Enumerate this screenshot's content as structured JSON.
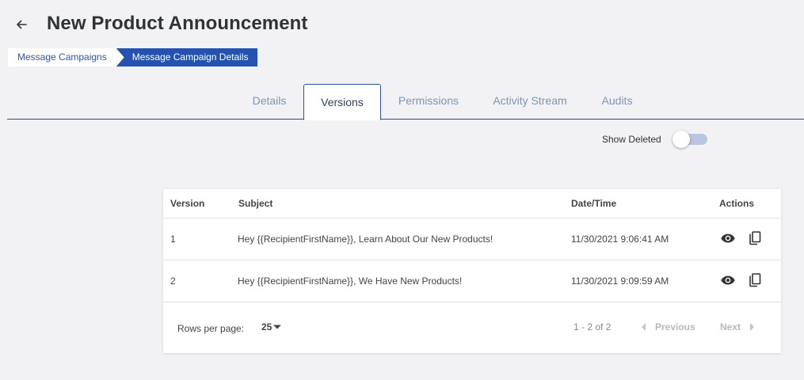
{
  "header": {
    "title": "New Product Announcement",
    "back_icon": "arrow-left-icon"
  },
  "breadcrumb": [
    {
      "label": "Message Campaigns"
    },
    {
      "label": "Message Campaign Details"
    }
  ],
  "tabs": [
    {
      "label": "Details",
      "active": false
    },
    {
      "label": "Versions",
      "active": true
    },
    {
      "label": "Permissions",
      "active": false
    },
    {
      "label": "Activity Stream",
      "active": false
    },
    {
      "label": "Audits",
      "active": false
    }
  ],
  "filters": {
    "show_deleted_label": "Show Deleted",
    "show_deleted": false
  },
  "table": {
    "columns": [
      "Version",
      "Subject",
      "Date/Time",
      "Actions"
    ],
    "rows": [
      {
        "version": "1",
        "subject": "Hey {{RecipientFirstName}}, Learn About Our New Products!",
        "datetime": "11/30/2021 9:06:41 AM"
      },
      {
        "version": "2",
        "subject": "Hey {{RecipientFirstName}}, We Have New Products!",
        "datetime": "11/30/2021 9:09:59 AM"
      }
    ],
    "action_icons": [
      "eye-icon",
      "copy-icon"
    ]
  },
  "pagination": {
    "rows_per_page_label": "Rows per page:",
    "rows_per_page": "25",
    "range": "1 - 2 of 2",
    "previous_label": "Previous",
    "next_label": "Next"
  },
  "colors": {
    "primary": "#2452b0",
    "tab_inactive": "#7f93b8",
    "background": "#f2f2f4"
  }
}
